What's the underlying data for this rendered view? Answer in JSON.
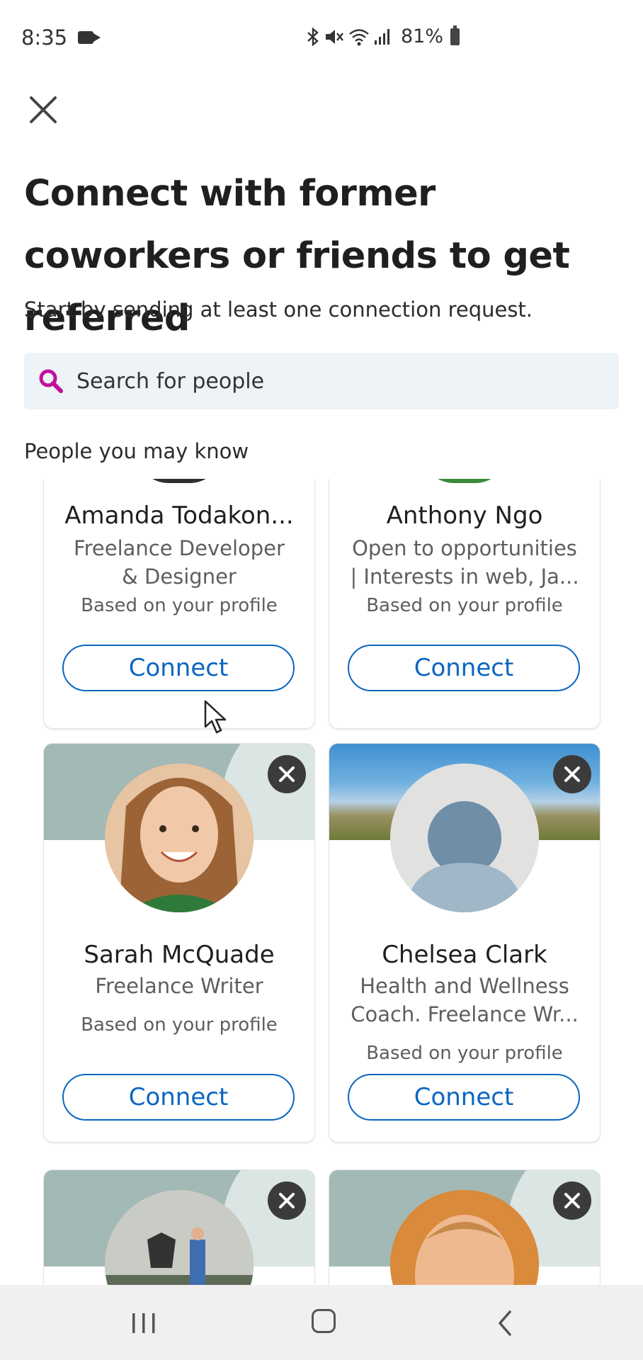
{
  "status_bar": {
    "time": "8:35",
    "battery": "81%",
    "icons": [
      "video-camera-icon",
      "bluetooth-icon",
      "mute-icon",
      "wifi-icon",
      "signal-icon",
      "battery-icon"
    ]
  },
  "header": {
    "close_icon": "close-icon",
    "title": "Connect with former coworkers or friends to get referred",
    "subtitle": "Start by sending at least one connection request."
  },
  "search": {
    "placeholder": "Search for people",
    "icon": "search-icon",
    "icon_color": "#c1119b"
  },
  "section": {
    "label": "People you may know"
  },
  "colors": {
    "accent": "#0a66c2",
    "banner": "#a3b9b6",
    "search_bg": "#edf3f6"
  },
  "cards": [
    {
      "name": "Amanda Todakon...",
      "headline_1": "Freelance Developer",
      "headline_2": "& Designer",
      "reason": "Based on your profile",
      "button": "Connect"
    },
    {
      "name": "Anthony Ngo",
      "headline_1": "Open to opportunities",
      "headline_2": "| Interests in web, Ja...",
      "reason": "Based on your profile",
      "button": "Connect"
    },
    {
      "name": "Sarah McQuade",
      "headline_1": "Freelance Writer",
      "headline_2": "",
      "reason": "Based on your profile",
      "button": "Connect"
    },
    {
      "name": "Chelsea Clark",
      "headline_1": "Health and Wellness",
      "headline_2": "Coach. Freelance Wr...",
      "reason": "Based on your profile",
      "button": "Connect"
    },
    {
      "name": "",
      "headline_1": "",
      "headline_2": "",
      "reason": "",
      "button": ""
    },
    {
      "name": "",
      "headline_1": "",
      "headline_2": "",
      "reason": "",
      "button": ""
    }
  ],
  "nav_bar": {
    "icons": [
      "recents-icon",
      "home-icon",
      "back-icon"
    ]
  }
}
